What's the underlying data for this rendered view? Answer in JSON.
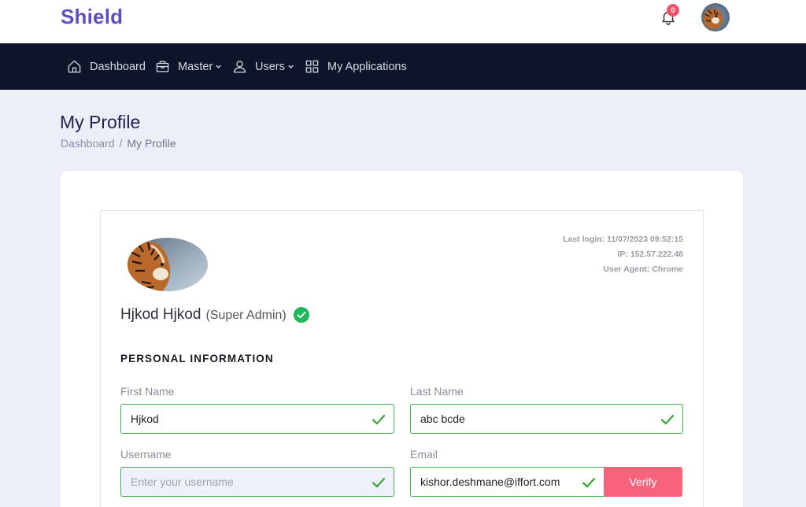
{
  "brand": {
    "name": "Shield",
    "color": "#5b4fc4"
  },
  "header": {
    "notifications_count": "0",
    "bell_icon": "bell-icon",
    "avatar": "user-avatar"
  },
  "nav": {
    "items": [
      {
        "label": "Dashboard",
        "icon": "home-icon",
        "has_dropdown": false
      },
      {
        "label": "Master",
        "icon": "briefcase-icon",
        "has_dropdown": true
      },
      {
        "label": "Users",
        "icon": "user-icon",
        "has_dropdown": true
      },
      {
        "label": "My Applications",
        "icon": "grid-icon",
        "has_dropdown": false
      }
    ]
  },
  "page": {
    "title": "My Profile",
    "breadcrumb": [
      "Dashboard",
      "My Profile"
    ],
    "breadcrumb_separator": "/"
  },
  "profile": {
    "last_login": "Last login: 11/07/2023 09:52:15",
    "ip": "IP: 152.57.222.48",
    "user_agent": "User Agent: Chrome",
    "name": "Hjkod Hjkod",
    "role": "(Super Admin)"
  },
  "personal_info": {
    "section_title": "PERSONAL INFORMATION",
    "first_name": {
      "label": "First Name",
      "value": "Hjkod"
    },
    "last_name": {
      "label": "Last Name",
      "value": "abc bcde"
    },
    "username": {
      "label": "Username",
      "placeholder": "Enter your username",
      "value": ""
    },
    "email": {
      "label": "Email",
      "value": "kishor.deshmane@iffort.com"
    },
    "verify_label": "Verify"
  },
  "colors": {
    "nav_bg": "#10142b",
    "page_bg": "#eceef8",
    "success": "#3fb34f",
    "verify": "#f7637a",
    "badge": "#f0526b"
  }
}
